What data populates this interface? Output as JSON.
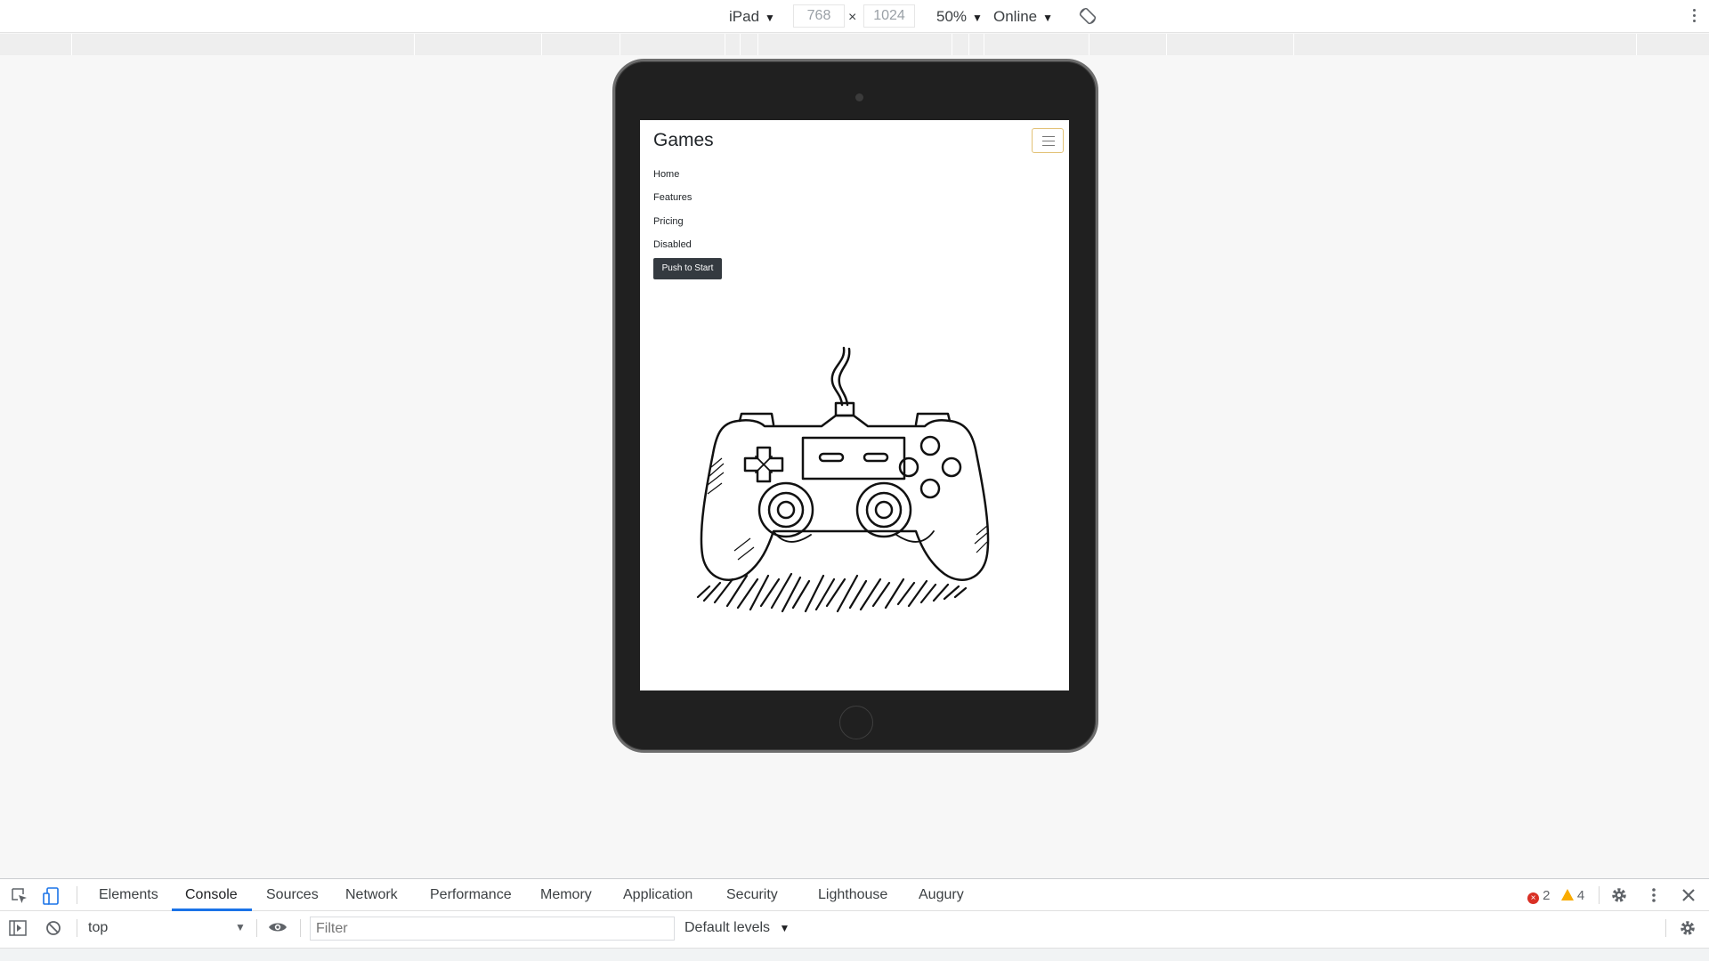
{
  "device_toolbar": {
    "device": "iPad",
    "width": "768",
    "times": "×",
    "height": "1024",
    "zoom": "50%",
    "network": "Online",
    "caret": "▼"
  },
  "page": {
    "brand": "Games",
    "nav": [
      "Home",
      "Features",
      "Pricing",
      "Disabled"
    ],
    "start_button": "Push to Start"
  },
  "devtools": {
    "tabs": [
      "Elements",
      "Console",
      "Sources",
      "Network",
      "Performance",
      "Memory",
      "Application",
      "Security",
      "Lighthouse",
      "Augury"
    ],
    "active_tab": "Console",
    "context": "top",
    "filter_placeholder": "Filter",
    "levels": "Default levels",
    "error_count": "2",
    "warning_count": "4"
  },
  "colors": {
    "accent": "#1a73e8",
    "toggler_border": "#e2c175",
    "button_bg": "#343a40",
    "error": "#d93025",
    "warning": "#f9ab00"
  }
}
